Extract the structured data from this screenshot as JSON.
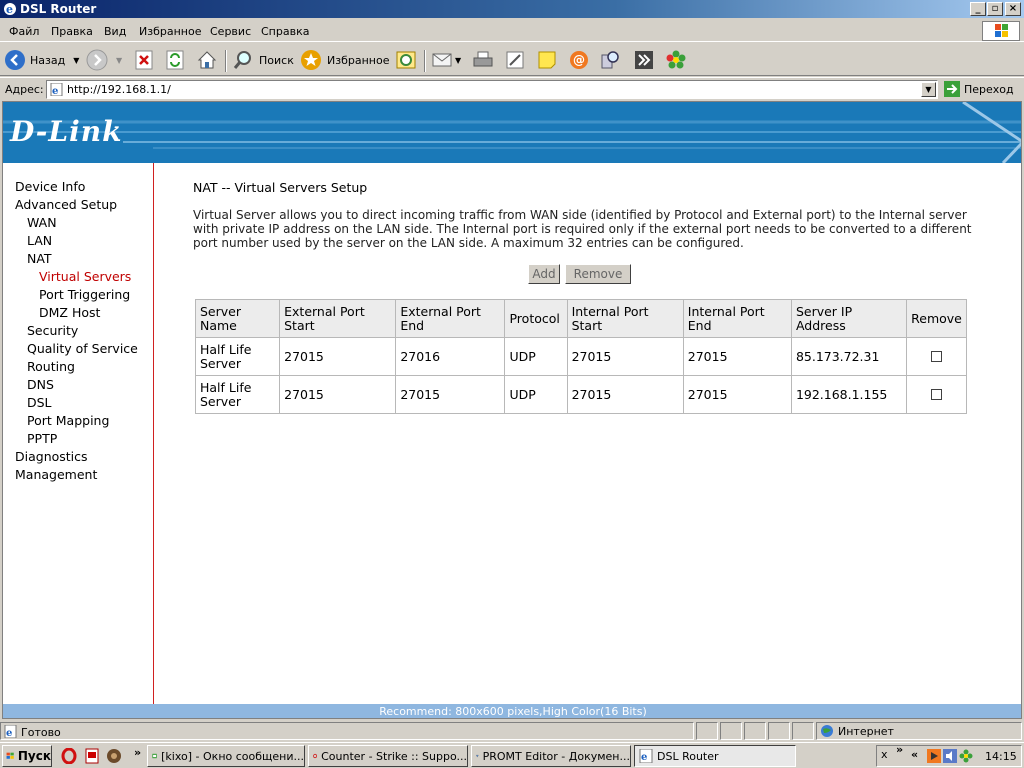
{
  "window": {
    "title": "DSL Router"
  },
  "menu": [
    "Файл",
    "Правка",
    "Вид",
    "Избранное",
    "Сервис",
    "Справка"
  ],
  "toolbar": {
    "back_label": "Назад",
    "search_label": "Поиск",
    "favorites_label": "Избранное"
  },
  "address": {
    "label": "Адрес:",
    "url": "http://192.168.1.1/",
    "go_label": "Переход"
  },
  "brand": {
    "logo_text": "D-Link"
  },
  "sidebar": {
    "items": [
      {
        "label": "Device Info",
        "level": 0
      },
      {
        "label": "Advanced Setup",
        "level": 0
      },
      {
        "label": "WAN",
        "level": 1
      },
      {
        "label": "LAN",
        "level": 1
      },
      {
        "label": "NAT",
        "level": 1
      },
      {
        "label": "Virtual Servers",
        "level": 2,
        "active": true
      },
      {
        "label": "Port Triggering",
        "level": 2
      },
      {
        "label": "DMZ Host",
        "level": 2
      },
      {
        "label": "Security",
        "level": 1
      },
      {
        "label": "Quality of Service",
        "level": 1
      },
      {
        "label": "Routing",
        "level": 1
      },
      {
        "label": "DNS",
        "level": 1
      },
      {
        "label": "DSL",
        "level": 1
      },
      {
        "label": "Port Mapping",
        "level": 1
      },
      {
        "label": "PPTP",
        "level": 1
      },
      {
        "label": "Diagnostics",
        "level": 0
      },
      {
        "label": "Management",
        "level": 0
      }
    ]
  },
  "main": {
    "title": "NAT -- Virtual Servers Setup",
    "description": "Virtual Server allows you to direct incoming traffic from WAN side (identified by Protocol and External port) to the Internal server with private IP address on the LAN side. The Internal port is required only if the external port needs to be converted to a different port number used by the server on the LAN side. A maximum 32 entries can be configured.",
    "add_label": "Add",
    "remove_label": "Remove",
    "table": {
      "headers": [
        "Server Name",
        "External Port Start",
        "External Port End",
        "Protocol",
        "Internal Port Start",
        "Internal Port End",
        "Server IP Address",
        "Remove"
      ],
      "rows": [
        {
          "server_name": "Half Life Server",
          "ext_start": "27015",
          "ext_end": "27016",
          "protocol": "UDP",
          "int_start": "27015",
          "int_end": "27015",
          "ip": "85.173.72.31",
          "remove": false
        },
        {
          "server_name": "Half Life Server",
          "ext_start": "27015",
          "ext_end": "27015",
          "protocol": "UDP",
          "int_start": "27015",
          "int_end": "27015",
          "ip": "192.168.1.155",
          "remove": false
        }
      ]
    },
    "recommend": "Recommend: 800x600 pixels,High Color(16 Bits)"
  },
  "statusbar": {
    "text": "Готово",
    "zone": "Интернет"
  },
  "taskbar": {
    "start_label": "Пуск",
    "tasks": [
      "[kixo] - Окно сообщени...",
      "Counter - Strike :: Suppo...",
      "PROMT Editor - Докумен...",
      "DSL Router"
    ],
    "tray_x": "x",
    "clock": "14:15"
  },
  "colors": {
    "banner": "#1a79b8",
    "active_nav": "#c00000",
    "sidebar_border": "#d02020",
    "recommend_bar": "#8fb7e0"
  }
}
